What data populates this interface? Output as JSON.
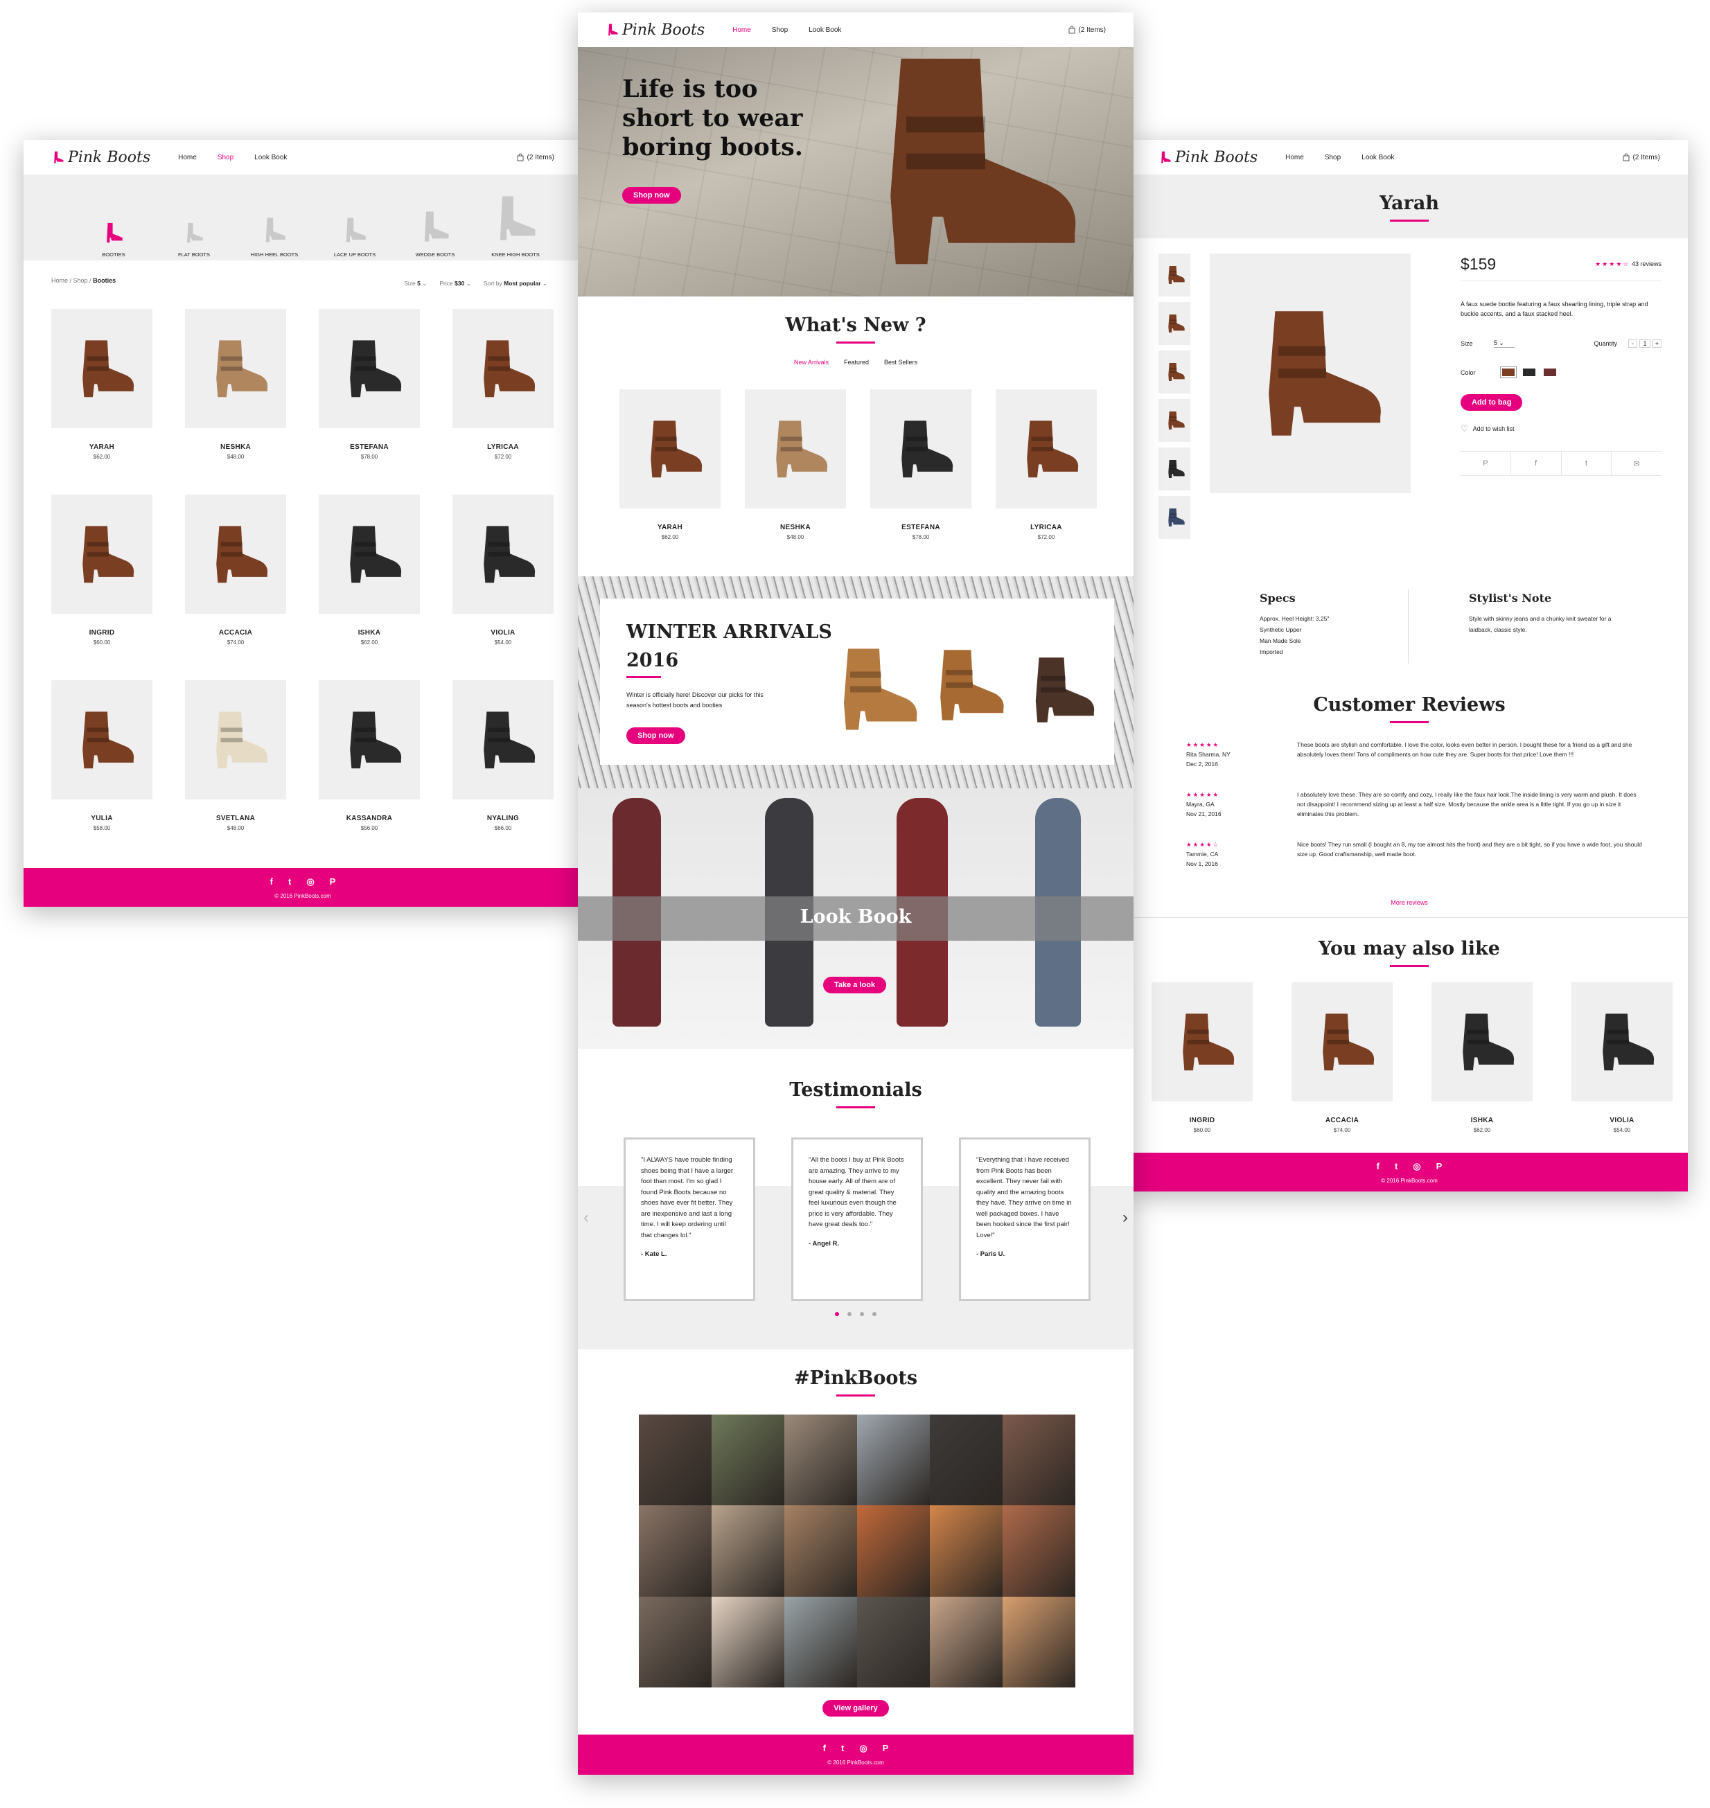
{
  "colors": {
    "accent": "#e6007e",
    "gray": "#efefef",
    "boot_brown": "#7a3e22",
    "boot_tan": "#b0865f",
    "boot_black": "#2a2a2a",
    "boot_cream": "#e6dcc5"
  },
  "brand": "Pink Boots",
  "nav": {
    "home": "Home",
    "shop": "Shop",
    "lookbook": "Look Book",
    "cart": "(2 Items)"
  },
  "shop_page": {
    "categories": [
      "BOOTIES",
      "FLAT BOOTS",
      "HIGH HEEL BOOTS",
      "LACE UP BOOTS",
      "WEDGE BOOTS",
      "KNEE HIGH BOOTS"
    ],
    "breadcrumb": {
      "home": "Home",
      "sep": " / ",
      "shop": "Shop",
      "current": "Booties"
    },
    "filters": {
      "size_label": "Size",
      "size_value": "5",
      "price_label": "Price",
      "price_value": "$30",
      "sort_label": "Sort by",
      "sort_value": "Most popular"
    },
    "products": [
      {
        "name": "YARAH",
        "price": "$62.00",
        "style": "brown"
      },
      {
        "name": "NESHKA",
        "price": "$48.00",
        "style": "tan"
      },
      {
        "name": "ESTEFANA",
        "price": "$78.00",
        "style": "black"
      },
      {
        "name": "LYRICAA",
        "price": "$72.00",
        "style": "brown"
      },
      {
        "name": "INGRID",
        "price": "$60.00",
        "style": "brown"
      },
      {
        "name": "ACCACIA",
        "price": "$74.00",
        "style": "brown"
      },
      {
        "name": "ISHKA",
        "price": "$62.00",
        "style": "black"
      },
      {
        "name": "VIOLIA",
        "price": "$54.00",
        "style": "black"
      },
      {
        "name": "YULIA",
        "price": "$58.00",
        "style": "brown"
      },
      {
        "name": "SVETLANA",
        "price": "$48.00",
        "style": "cream"
      },
      {
        "name": "KASSANDRA",
        "price": "$56.00",
        "style": "black"
      },
      {
        "name": "NYALING",
        "price": "$66.00",
        "style": "black"
      }
    ],
    "copyright": "© 2016 PinkBoots.com"
  },
  "home_page": {
    "hero_title_1": "Life is too",
    "hero_title_2": "short to wear",
    "hero_title_3": "boring boots.",
    "hero_cta": "Shop now",
    "whats_new_title": "What's New ?",
    "tabs": [
      "New Arrivals",
      "Featured",
      "Best Sellers"
    ],
    "new_products": [
      {
        "name": "YARAH",
        "price": "$62.00",
        "style": "brown"
      },
      {
        "name": "NESHKA",
        "price": "$48.00",
        "style": "tan"
      },
      {
        "name": "ESTEFANA",
        "price": "$78.00",
        "style": "black"
      },
      {
        "name": "LYRICAA",
        "price": "$72.00",
        "style": "brown"
      }
    ],
    "winter_title_1": "WINTER ARRIVALS",
    "winter_title_2": "2016",
    "winter_text_1": "Winter is officially here! Discover our picks for this",
    "winter_text_2": "season's hottest boots and booties",
    "winter_cta": "Shop now",
    "lookbook_title": "Look Book",
    "lookbook_cta": "Take a look",
    "testimonials_title": "Testimonials",
    "testimonials": [
      {
        "text": "\"I ALWAYS have trouble finding shoes being that I have a larger foot than most. I'm so glad I found Pink Boots because no shoes have ever fit better. They are inexpensive and last a long time. I will keep ordering until that changes lol.\"",
        "author": "- Kate L."
      },
      {
        "text": "\"All the boots I buy at Pink Boots are amazing. They arrive to my house early. All of them are of great quality & material. They feel luxurious even though the price is very affordable. They have great deals too.\"",
        "author": "- Angel R."
      },
      {
        "text": "\"Everything that I have received from Pink Boots has been excellent. They never fail with quality and the amazing boots they have. They arrive on time in well packaged boxes. I have been hooked since the first pair! Love!\"",
        "author": "- Paris U."
      }
    ],
    "hashtag_title": "#PinkBoots",
    "gallery_cta": "View gallery",
    "copyright": "© 2016 PinkBoots.com"
  },
  "product_page": {
    "title": "Yarah",
    "price": "$159",
    "rating_stars": "★★★★☆",
    "rating_value": 4,
    "reviews_count": "43 reviews",
    "description": "A faux suede bootie featuring a faux shearling lining, triple strap and buckle accents, and a faux stacked heel.",
    "size_label": "Size",
    "size_value": "5",
    "quantity_label": "Quantity",
    "quantity_value": "1",
    "color_label": "Color",
    "swatches": [
      "#7a3e22",
      "#2b2b2b",
      "#6b2f2f"
    ],
    "add_to_bag": "Add to bag",
    "wishlist": "Add to wish list",
    "share": [
      "P",
      "f",
      "t",
      "✉"
    ],
    "specs_title": "Specs",
    "specs": [
      "Approx. Heel Height: 3.25\"",
      "Synthetic Upper",
      "Man Made Sole",
      "Imported"
    ],
    "stylist_title": "Stylist's Note",
    "stylist_text": "Style with skinny jeans and a chunky knit sweater for a laidback, classic style.",
    "reviews_title": "Customer Reviews",
    "reviews": [
      {
        "stars": "★★★★★",
        "name": "Rita Sharma, NY",
        "date": "Dec 2, 2016",
        "text": "These boots are stylish and comfortable. I love the color, looks even better in person. I bought these for a friend as a gift and she absolutely loves them! Tons of compliments on how cute they are. Super boots for that price! Love them !!!"
      },
      {
        "stars": "★★★★★",
        "name": "Mayra, GA",
        "date": "Nov 21, 2016",
        "text": "I absolutely love these. They are so comfy and cozy. I really like the faux hair look.The inside lining is very warm and plush. It does not disappoint! I recommend sizing up at least a half size. Mostly because the ankle area is a little tight. If you go up in size it eliminates this problem."
      },
      {
        "stars": "★★★★☆",
        "name": "Tammie, CA",
        "date": "Nov 1, 2016",
        "text": "Nice boots! They run small (I bought an 8, my toe almost hits the front) and they are a bit tight, so if you have a wide foot, you should size up. Good craftsmanship, well made boot."
      }
    ],
    "more_reviews": "More reviews",
    "also_like_title": "You may also like",
    "also_like": [
      {
        "name": "INGRID",
        "price": "$60.00",
        "style": "brown"
      },
      {
        "name": "ACCACIA",
        "price": "$74.00",
        "style": "brown"
      },
      {
        "name": "ISHKA",
        "price": "$62.00",
        "style": "black"
      },
      {
        "name": "VIOLIA",
        "price": "$54.00",
        "style": "black"
      }
    ],
    "copyright": "© 2016 PinkBoots.com"
  },
  "footer_icons": [
    "f",
    "t",
    "◎",
    "P"
  ]
}
